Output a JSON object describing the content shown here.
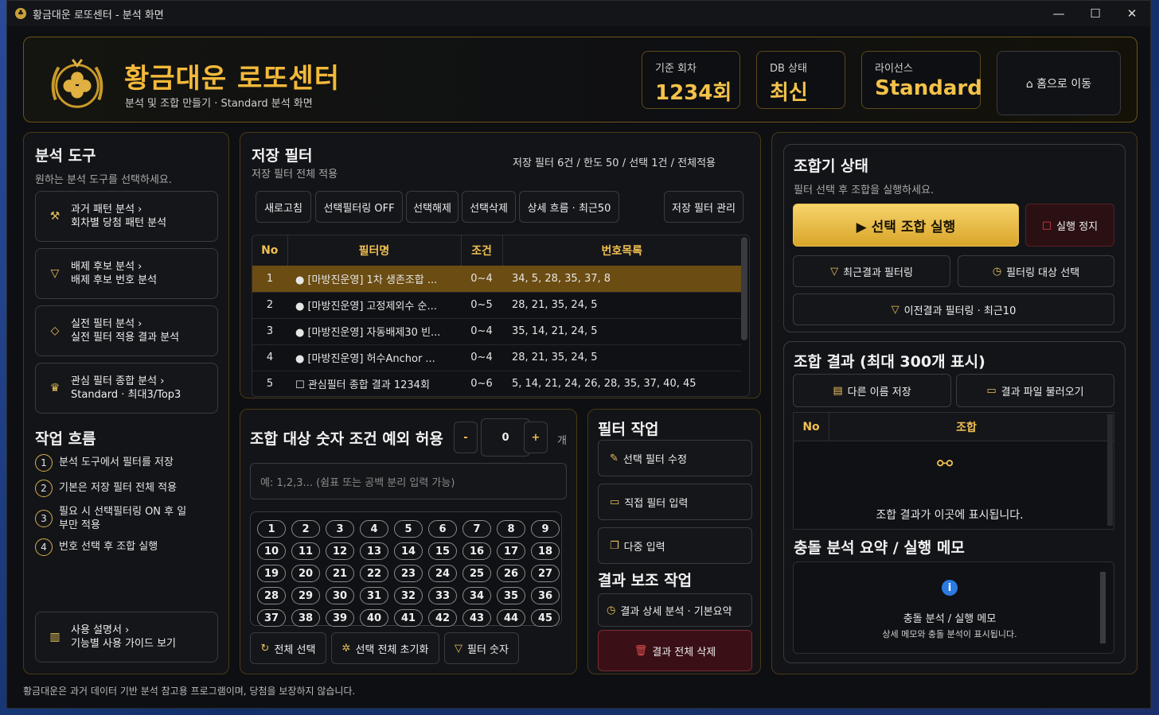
{
  "window": {
    "title": "황금대운 로또센터 - 분석 화면",
    "min": "—",
    "max": "☐",
    "close": "✕"
  },
  "header": {
    "title": "황금대운 로또센터",
    "subtitle": "분석 및 조합 만들기 · Standard 분석 화면",
    "stats": [
      {
        "label": "기준 회차",
        "value": "1234회"
      },
      {
        "label": "DB 상태",
        "value": "최신"
      },
      {
        "label": "라이선스",
        "value": "Standard"
      }
    ],
    "home": "⌂ 홈으로 이동"
  },
  "tools": {
    "title": "분석 도구",
    "subtitle": "원하는 분석 도구를 선택하세요.",
    "items": [
      {
        "icon": "⚒",
        "t1": "과거 패턴 분석  ›",
        "t2": "회차별 당첨 패턴 분석"
      },
      {
        "icon": "▽",
        "t1": "배제 후보 분석  ›",
        "t2": "배제 후보 번호 분석"
      },
      {
        "icon": "◇",
        "t1": "실전 필터 분석  ›",
        "t2": "실전 필터 적용 결과 분석"
      },
      {
        "icon": "♛",
        "t1": "관심 필터 종합 분석  ›",
        "t2": "Standard · 최대3/Top3"
      }
    ],
    "flow_title": "작업 흐름",
    "flow": [
      {
        "n": "1",
        "t": "분석 도구에서 필터를 저장"
      },
      {
        "n": "2",
        "t": "기본은 저장 필터 전체 적용"
      },
      {
        "n": "3",
        "t": "필요 시 선택필터링 ON 후 일부만 적용"
      },
      {
        "n": "4",
        "t": "번호 선택 후 조합 실행"
      }
    ],
    "guide": {
      "t1": "사용 설명서  ›",
      "t2": "기능별 사용 가이드 보기"
    }
  },
  "saved": {
    "title": "저장 필터",
    "subtitle": "저장 필터 전체 적용",
    "info": "저장 필터 6건 / 한도 50 / 선택 1건 / 전체적용",
    "buttons": [
      "새로고침",
      "선택필터링 OFF",
      "선택해제",
      "선택삭제",
      "상세 흐름 · 최근50",
      "저장 필터 관리"
    ],
    "columns": [
      "No",
      "필터명",
      "조건",
      "번호목록"
    ],
    "rows": [
      [
        "1",
        "● [마방진운영] 1차 생존조합 ...",
        "0~4",
        "34, 5, 28, 35, 37, 8"
      ],
      [
        "2",
        "● [마방진운영] 고정제외수 순...",
        "0~5",
        "28, 21, 35, 24, 5"
      ],
      [
        "3",
        "● [마방진운영] 자동배제30 빈...",
        "0~4",
        "35, 14, 21, 24, 5"
      ],
      [
        "4",
        "● [마방진운영] 허수Anchor ...",
        "0~4",
        "28, 21, 35, 24, 5"
      ],
      [
        "5",
        "☐ 관심필터 종합 결과 1234회",
        "0~6",
        "5, 14, 21, 24, 26, 28, 35, 37, 40, 45"
      ]
    ]
  },
  "numbers": {
    "title": "조합 대상 숫자 조건 예외 허용",
    "minus": "-",
    "value": "0",
    "plus": "+",
    "unit": "개",
    "placeholder": "예: 1,2,3... (쉼표 또는 공백 분리 입력 가능)",
    "list": [
      "1",
      "2",
      "3",
      "4",
      "5",
      "6",
      "7",
      "8",
      "9",
      "10",
      "11",
      "12",
      "13",
      "14",
      "15",
      "16",
      "17",
      "18",
      "19",
      "20",
      "21",
      "22",
      "23",
      "24",
      "25",
      "26",
      "27",
      "28",
      "29",
      "30",
      "31",
      "32",
      "33",
      "34",
      "35",
      "36",
      "37",
      "38",
      "39",
      "40",
      "41",
      "42",
      "43",
      "44",
      "45"
    ],
    "b1": "전체 선택",
    "b2": "선택 전체 초기화",
    "b3": "필터 숫자"
  },
  "filterwork": {
    "title": "필터 작업",
    "b1": "선택 필터 수정",
    "b2": "직접 필터 입력",
    "b3": "다중 입력",
    "title2": "결과 보조 작업",
    "b4": "결과 상세 분석 · 기본요약",
    "b5": "결과 전체 삭제"
  },
  "combiner": {
    "title": "조합기 상태",
    "subtitle": "필터 선택 후 조합을 실행하세요.",
    "run": "▶ 선택 조합 실행",
    "stop": "실행 정지",
    "f1": "최근결과 필터링",
    "f2": "필터링 대상 선택",
    "f3": "이전결과 필터링 · 최근10"
  },
  "result": {
    "title": "조합 결과 (최대 300개 표시)",
    "save": "다른 이름 저장",
    "load": "결과 파일 불러오기",
    "col_no": "No",
    "col_combo": "조합",
    "empty": "조합 결과가 이곳에 표시됩니다."
  },
  "memo": {
    "title": "충돌 분석 요약 / 실행 메모",
    "t1": "충돌 분석 / 실행 메모",
    "t2": "상세 메모와 충돌 분석이 표시됩니다."
  },
  "footer": "황금대운은 과거 데이터 기반 분석 참고용 프로그램이며, 당첨을 보장하지 않습니다."
}
